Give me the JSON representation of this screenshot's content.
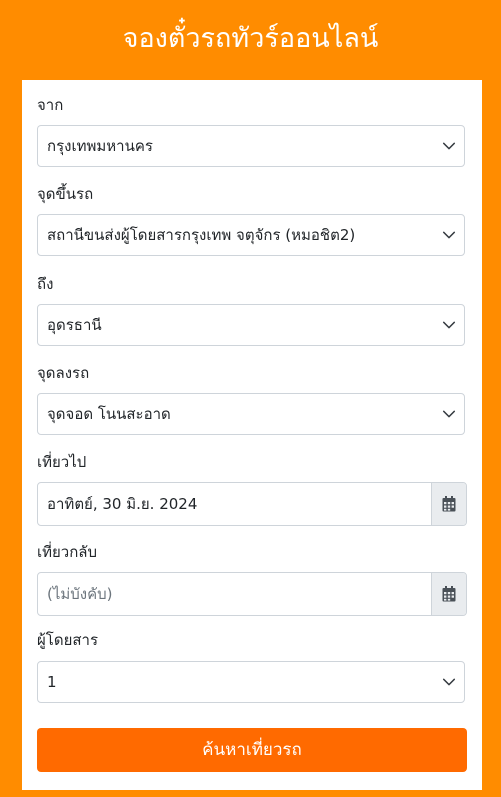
{
  "header": {
    "title": "จองตั๋วรถทัวร์ออนไลน์"
  },
  "form": {
    "origin": {
      "label": "จาก",
      "value": "กรุงเทพมหานคร"
    },
    "boarding_point": {
      "label": "จุดขึ้นรถ",
      "value": "สถานีขนส่งผู้โดยสารกรุงเทพ จตุจักร (หมอชิต2)"
    },
    "destination": {
      "label": "ถึง",
      "value": "อุดรธานี"
    },
    "drop_point": {
      "label": "จุดลงรถ",
      "value": "จุดจอด โนนสะอาด"
    },
    "departure": {
      "label": "เที่ยวไป",
      "value": "อาทิตย์, 30 มิ.ย. 2024"
    },
    "return": {
      "label": "เที่ยวกลับ",
      "placeholder": "(ไม่บังคับ)"
    },
    "passengers": {
      "label": "ผู้โดยสาร",
      "value": "1"
    },
    "search_label": "ค้นหาเที่ยวรถ"
  },
  "colors": {
    "background": "#ff8c00",
    "button": "#ff6a00",
    "card": "#ffffff",
    "addon": "#e9ecef"
  },
  "icons": {
    "select_arrow": "chevron-down-icon",
    "date_picker": "calendar-icon"
  }
}
